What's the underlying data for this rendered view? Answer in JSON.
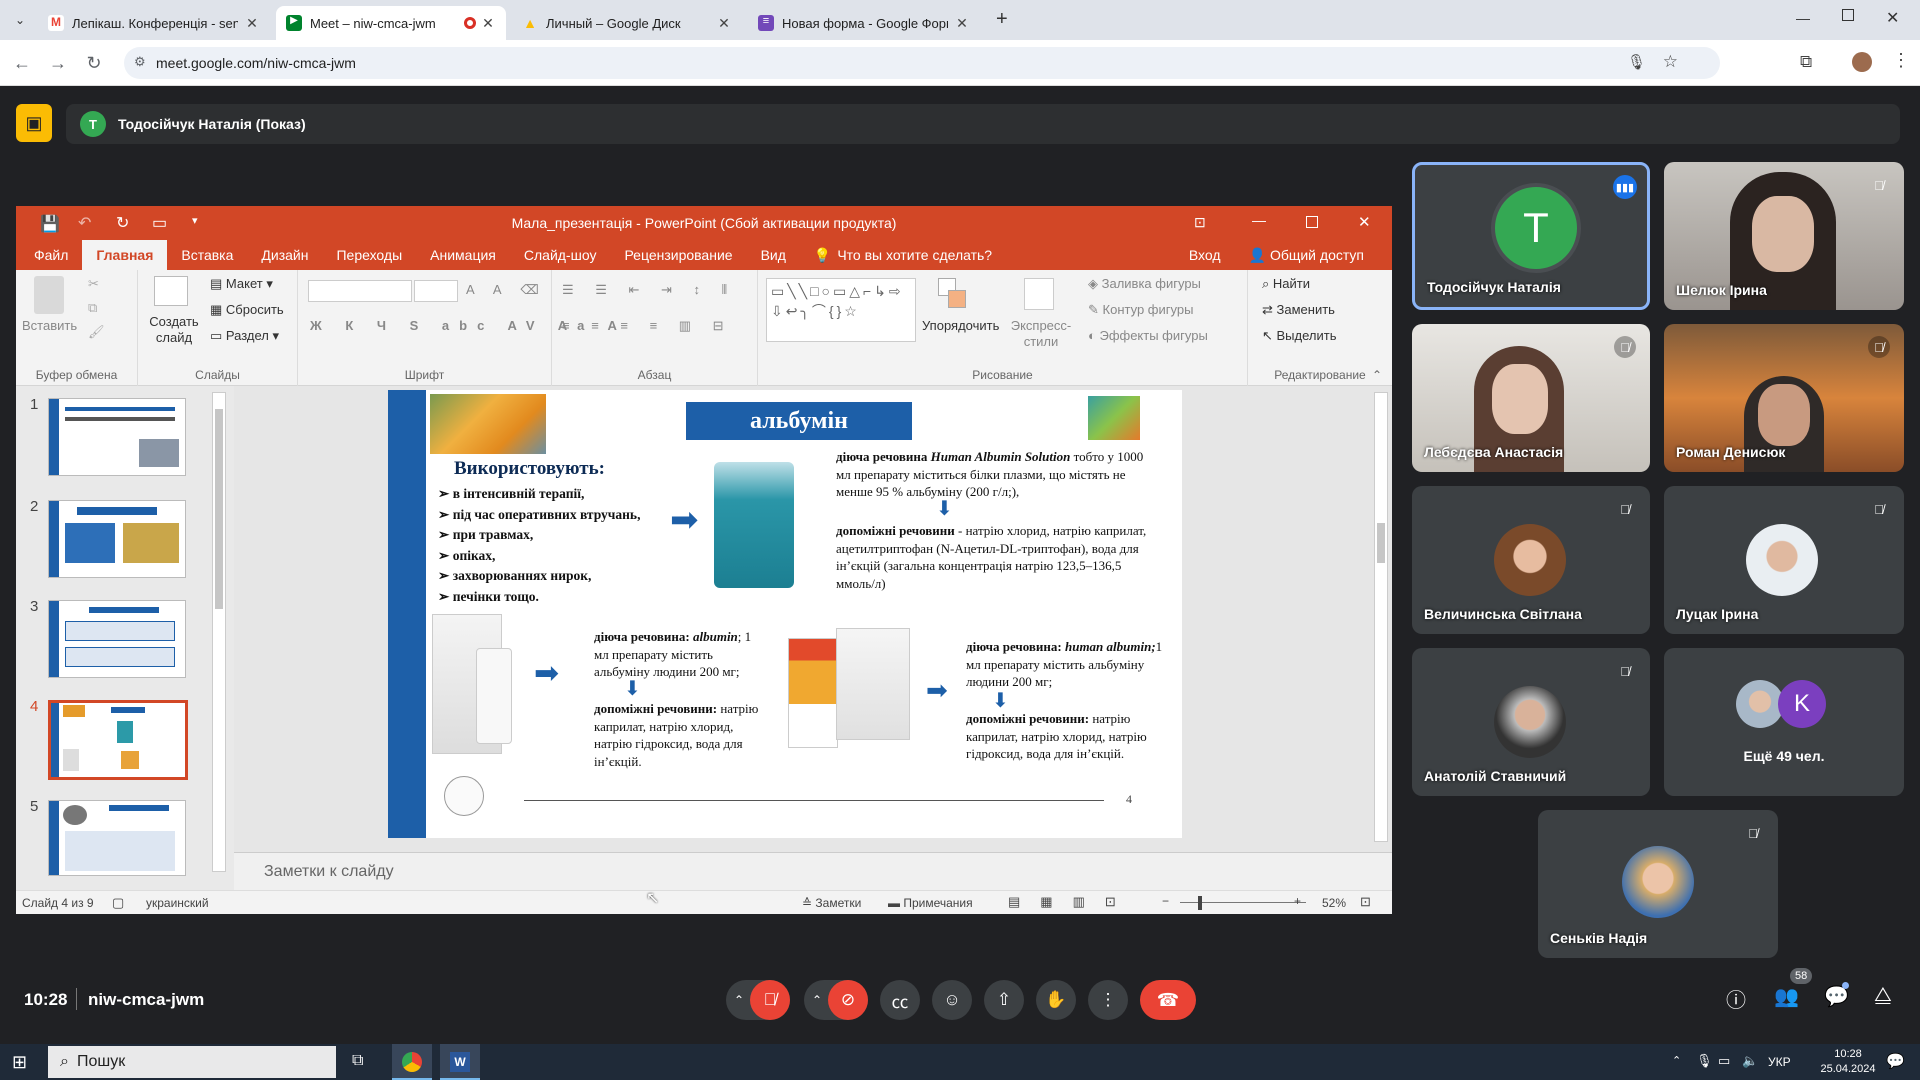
{
  "browser": {
    "tabs": [
      {
        "label": "Лепікаш. Конференція - senk",
        "color": "#ea4335",
        "glyph": "M"
      },
      {
        "label": "Meet – niw-cmca-jwm",
        "color": "#00832d",
        "glyph": "▶"
      },
      {
        "label": "Личный – Google Диск",
        "color": "#fbbc04",
        "glyph": "▲"
      },
      {
        "label": "Новая форма - Google Форм",
        "color": "#7248b9",
        "glyph": "≡"
      }
    ],
    "new_tab": "+",
    "url": "meet.google.com/niw-cmca-jwm"
  },
  "meet": {
    "presenter_initial": "Т",
    "presenter_banner": "Тодосійчук Наталія (Показ)",
    "time": "10:28",
    "meeting_code": "niw-cmca-jwm",
    "participants_count": "58",
    "participants": [
      {
        "name": "Тодосійчук Наталія",
        "initial": "Т"
      },
      {
        "name": "Шелюк Ірина"
      },
      {
        "name": "Лебєдєва Анастасія"
      },
      {
        "name": "Роман Денисюк"
      },
      {
        "name": "Величинська Світлана"
      },
      {
        "name": "Луцак Ірина"
      },
      {
        "name": "Анатолій Ставничий"
      },
      {
        "name": "Ещё 49 чел.",
        "initial": "K"
      },
      {
        "name": "Сеньків Надія"
      }
    ]
  },
  "ppt": {
    "title": "Мала_презентація - PowerPoint (Сбой активации продукта)",
    "tabs": [
      "Файл",
      "Главная",
      "Вставка",
      "Дизайн",
      "Переходы",
      "Анимация",
      "Слайд-шоу",
      "Рецензирование",
      "Вид"
    ],
    "tellme": "Что вы хотите сделать?",
    "signin": "Вход",
    "share": "Общий доступ",
    "ribbon": {
      "paste": "Вставить",
      "new_slide": "Создать слайд",
      "layout": "Макет",
      "reset": "Сбросить",
      "section": "Раздел",
      "arrange": "Упорядочить",
      "quick_styles": "Экспресс-стили",
      "fill": "Заливка фигуры",
      "outline": "Контур фигуры",
      "effects": "Эффекты фигуры",
      "find": "Найти",
      "replace": "Заменить",
      "select": "Выделить",
      "groups": [
        "Буфер обмена",
        "Слайды",
        "Шрифт",
        "Абзац",
        "Рисование",
        "Редактирование"
      ]
    },
    "thumb_numbers": [
      "1",
      "2",
      "3",
      "4",
      "5"
    ],
    "notes_placeholder": "Заметки к слайду",
    "status": {
      "slide": "Слайд 4 из 9",
      "lang": "украинский",
      "notes": "Заметки",
      "comments": "Примечания",
      "zoom": "52%"
    },
    "slide": {
      "title": "альбумін",
      "uses_heading": "Використовують:",
      "uses": [
        "в інтенсивній терапії,",
        "під час оперативних втручань,",
        " при травмах,",
        "опіках,",
        "захворюваннях нирок,",
        "печінки тощо."
      ],
      "p1a": "діюча речовина ",
      "p1b": "Human Albumin Solution",
      "p1c": " тобто у 1000 мл препарату міститься білки плазми, що містять не менше 95 % альбуміну (200 г/л;),",
      "p2a": "допоміжні речовини",
      "p2b": " - натрію хлорид, натрію каприлат, ацетилтриптофан (N-Ацетил-DL-триптофан), вода для ін’єкцій (загальна концентрація натрію 123,5–136,5 ммоль/л)",
      "p3a": "діюча речовина: ",
      "p3b": "albumin",
      "p3c": "; 1 мл препарату містить альбуміну людини 200 мг;",
      "p4a": "допоміжні речовини:",
      "p4b": " натрію каприлат, натрію хлорид, натрію гідроксид, вода для ін’єкцій.",
      "p5a": "діюча речовина: ",
      "p5b": "human albumin;",
      "p5c": "1 мл препарату містить альбуміну людини 200 мг;",
      "p6a": "допоміжні речовини:",
      "p6b": " натрію каприлат, натрію хлорид, натрію гідроксид, вода для ін’єкцій.",
      "page": "4"
    }
  },
  "taskbar": {
    "search": "Пошук",
    "lang": "УКР",
    "time": "10:28",
    "date": "25.04.2024"
  },
  "colors": {
    "ppt_accent": "#d24726",
    "meet_bg": "#202124",
    "slide_blue": "#1d5fa8"
  }
}
